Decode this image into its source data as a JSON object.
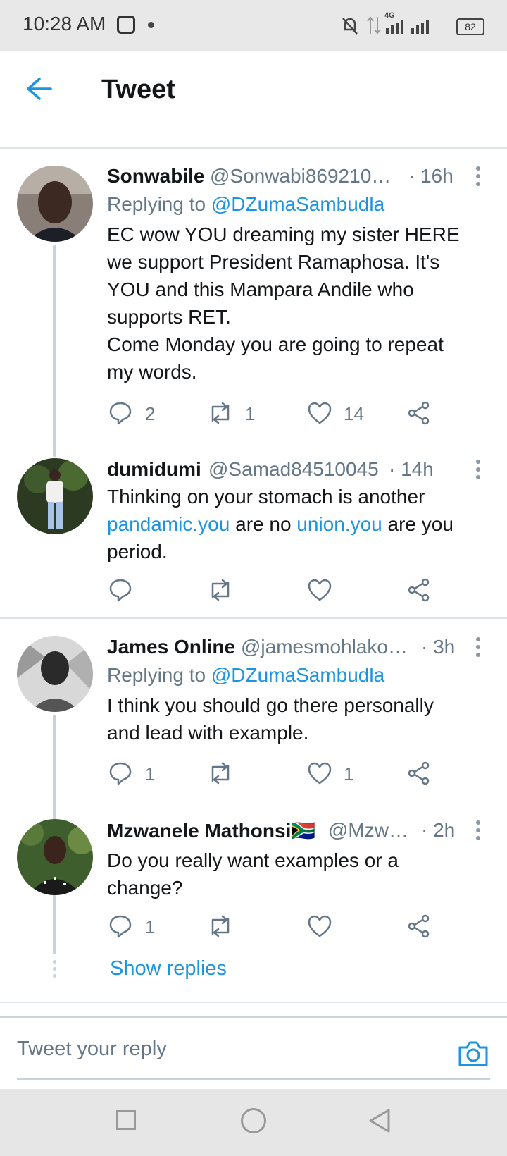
{
  "status_bar": {
    "time": "10:28 AM",
    "network": "4G",
    "battery": "82"
  },
  "header": {
    "title": "Tweet"
  },
  "tweets": [
    {
      "name": "Sonwabile",
      "handle": "@Sonwabi869210…",
      "time": "· 16h",
      "replying_label": "Replying to",
      "replying_to": "@DZumaSambudla",
      "text_lines": [
        "EC wow YOU dreaming my sister HERE",
        "we support President Ramaphosa. It's",
        "YOU and this Mampara Andile who",
        "supports RET.",
        "Come Monday you are going to repeat",
        "my words."
      ],
      "replies": "2",
      "retweets": "1",
      "likes": "14"
    },
    {
      "name": "dumidumi",
      "handle": "@Samad84510045",
      "time": "· 14h",
      "text_parts": {
        "p1": "Thinking on your stomach is another",
        "link1": "pandamic.you",
        "p2": " are no ",
        "link2": "union.you",
        "p3": " are you",
        "p4": "period."
      },
      "replies": "",
      "retweets": "",
      "likes": ""
    },
    {
      "name": "James Online",
      "handle": "@jamesmohlako…",
      "time": "· 3h",
      "replying_label": "Replying to",
      "replying_to": "@DZumaSambudla",
      "text_lines": [
        "I think you should go there personally",
        "and lead with example."
      ],
      "replies": "1",
      "retweets": "",
      "likes": "1"
    },
    {
      "name": "Mzwanele Mathonsi🇿🇦",
      "handle": "@Mzw…",
      "time": "· 2h",
      "text_lines": [
        "Do you really want examples or a",
        "change?"
      ],
      "replies": "1",
      "retweets": "",
      "likes": ""
    }
  ],
  "show_replies": "Show replies",
  "reply_box": {
    "placeholder": "Tweet your reply"
  },
  "colors": {
    "accent": "#1b95e0",
    "secondary_text": "#657786",
    "thread_line": "#c6d2dc"
  },
  "icons": [
    "back-arrow-icon",
    "reply-icon",
    "retweet-icon",
    "like-icon",
    "share-icon",
    "more-icon",
    "camera-icon",
    "recents-icon",
    "home-icon",
    "back-icon"
  ]
}
